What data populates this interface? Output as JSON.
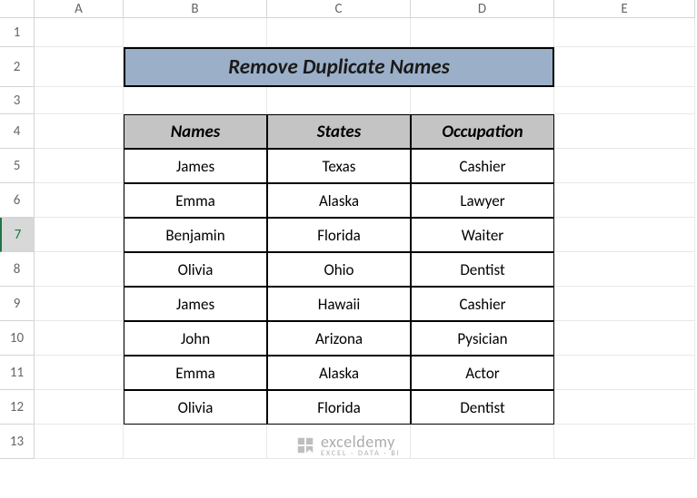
{
  "columns": [
    "A",
    "B",
    "C",
    "D",
    "E"
  ],
  "rows": [
    "1",
    "2",
    "3",
    "4",
    "5",
    "6",
    "7",
    "8",
    "9",
    "10",
    "11",
    "12",
    "13"
  ],
  "selected_row": "7",
  "title": "Remove Duplicate Names",
  "headers": {
    "names": "Names",
    "states": "States",
    "occupation": "Occupation"
  },
  "chart_data": {
    "type": "table",
    "title": "Remove Duplicate Names",
    "columns": [
      "Names",
      "States",
      "Occupation"
    ],
    "rows": [
      [
        "James",
        "Texas",
        "Cashier"
      ],
      [
        "Emma",
        "Alaska",
        "Lawyer"
      ],
      [
        "Benjamin",
        "Florida",
        "Waiter"
      ],
      [
        "Olivia",
        "Ohio",
        "Dentist"
      ],
      [
        "James",
        "Hawaii",
        "Cashier"
      ],
      [
        "John",
        "Arizona",
        "Pysician"
      ],
      [
        "Emma",
        "Alaska",
        "Actor"
      ],
      [
        "Olivia",
        "Florida",
        "Dentist"
      ]
    ]
  },
  "watermark": {
    "brand": "exceldemy",
    "tag": "EXCEL · DATA · BI"
  }
}
